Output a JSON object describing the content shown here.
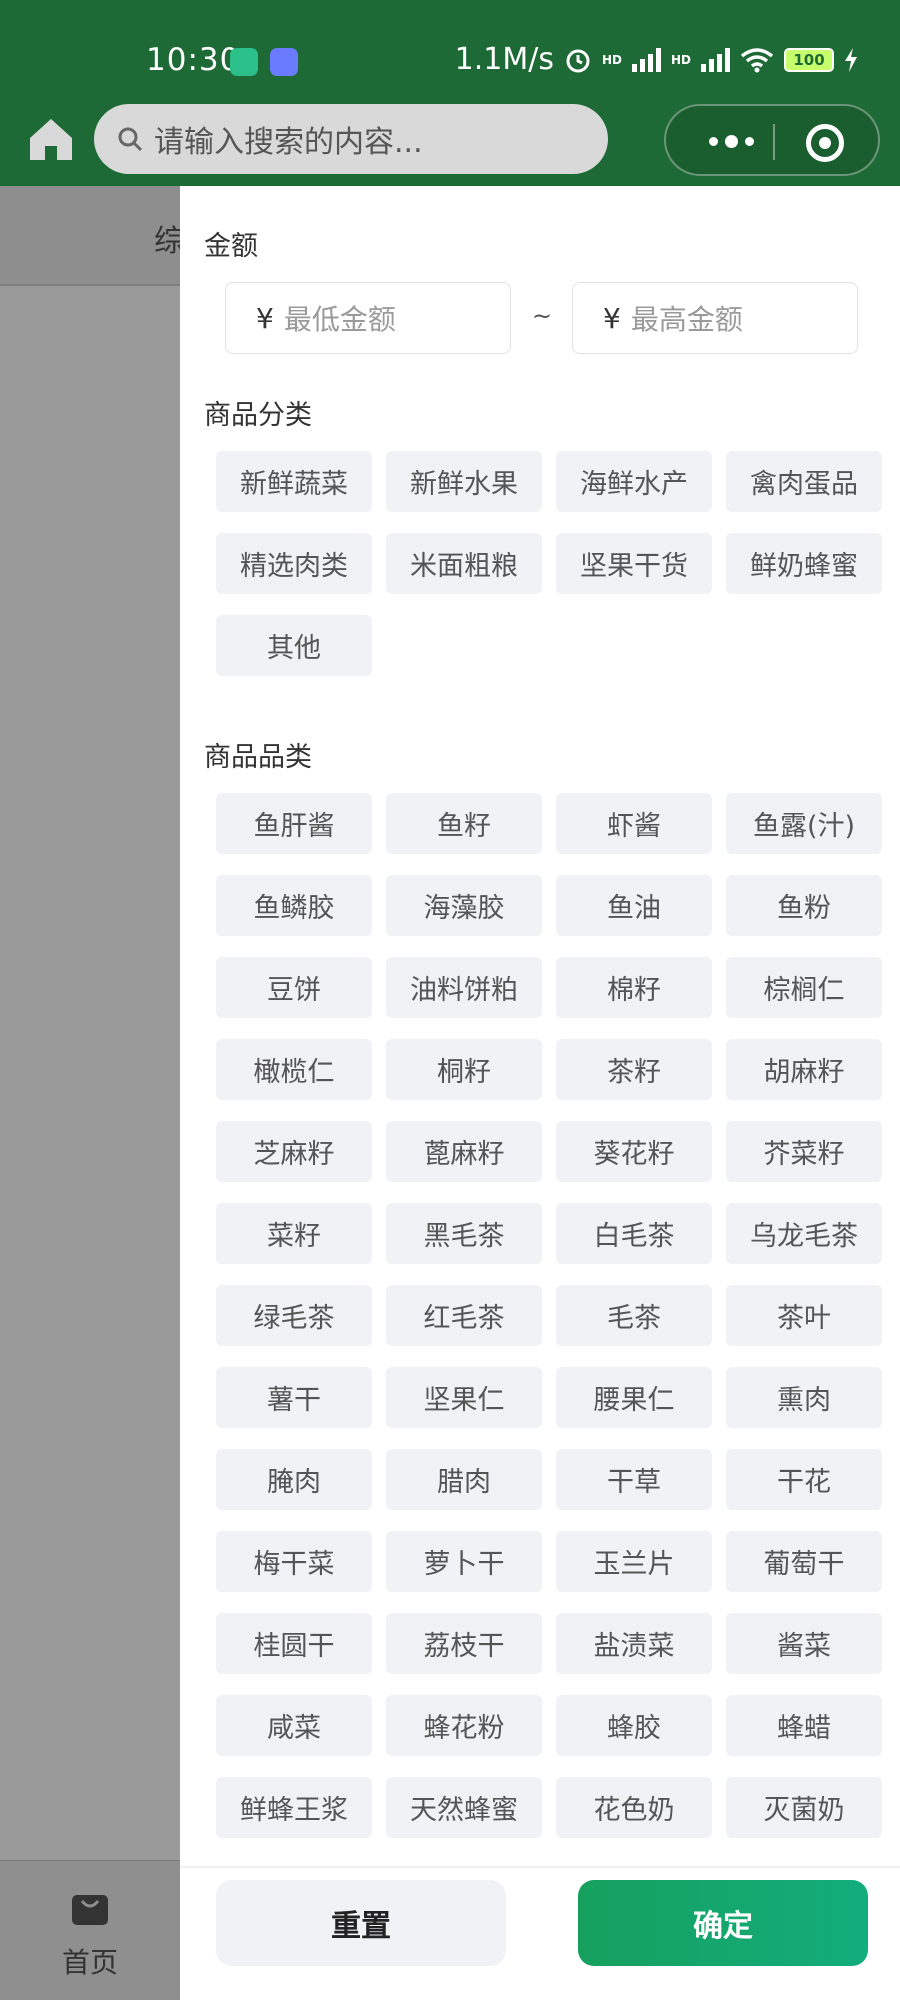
{
  "status_bar": {
    "time": "10:30",
    "speed": "1.1M/s",
    "battery": "100",
    "hd_label": "HD"
  },
  "header": {
    "search_placeholder": "请输入搜索的内容..."
  },
  "background_page": {
    "tab_partial": "综",
    "tabbar_home": "首页"
  },
  "filter": {
    "amount_title": "金额",
    "min_placeholder": "最低金额",
    "max_placeholder": "最高金额",
    "currency": "¥",
    "separator": "~",
    "category_title": "商品分类",
    "categories": [
      "新鲜蔬菜",
      "新鲜水果",
      "海鲜水产",
      "禽肉蛋品",
      "精选肉类",
      "米面粗粮",
      "坚果干货",
      "鲜奶蜂蜜",
      "其他"
    ],
    "type_title": "商品品类",
    "types": [
      "鱼肝酱",
      "鱼籽",
      "虾酱",
      "鱼露(汁)",
      "鱼鳞胶",
      "海藻胶",
      "鱼油",
      "鱼粉",
      "豆饼",
      "油料饼粕",
      "棉籽",
      "棕榈仁",
      "橄榄仁",
      "桐籽",
      "茶籽",
      "胡麻籽",
      "芝麻籽",
      "蓖麻籽",
      "葵花籽",
      "芥菜籽",
      "菜籽",
      "黑毛茶",
      "白毛茶",
      "乌龙毛茶",
      "绿毛茶",
      "红毛茶",
      "毛茶",
      "茶叶",
      "薯干",
      "坚果仁",
      "腰果仁",
      "熏肉",
      "腌肉",
      "腊肉",
      "干草",
      "干花",
      "梅干菜",
      "萝卜干",
      "玉兰片",
      "葡萄干",
      "桂圆干",
      "荔枝干",
      "盐渍菜",
      "酱菜",
      "咸菜",
      "蜂花粉",
      "蜂胶",
      "蜂蜡",
      "鲜蜂王浆",
      "天然蜂蜜",
      "花色奶",
      "灭菌奶"
    ],
    "reset_label": "重置",
    "confirm_label": "确定"
  },
  "colors": {
    "header_green": "#1e6a36",
    "confirm_green": "#16a05e",
    "chip_bg": "#f1f2f6"
  }
}
